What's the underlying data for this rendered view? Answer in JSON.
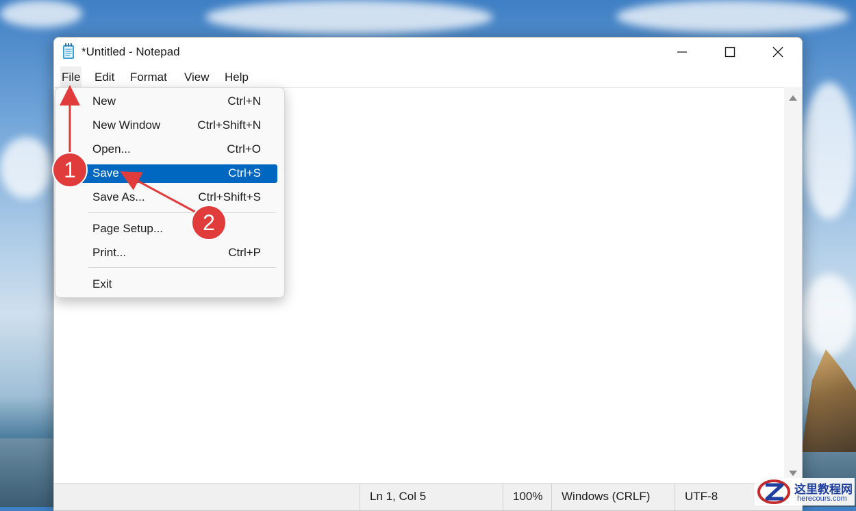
{
  "window": {
    "title": "*Untitled - Notepad",
    "app_icon": "notepad-icon"
  },
  "menubar": {
    "items": [
      "File",
      "Edit",
      "Format",
      "View",
      "Help"
    ],
    "active": "File"
  },
  "file_menu": {
    "items": [
      {
        "label": "New",
        "shortcut": "Ctrl+N"
      },
      {
        "label": "New Window",
        "shortcut": "Ctrl+Shift+N"
      },
      {
        "label": "Open...",
        "shortcut": "Ctrl+O"
      },
      {
        "label": "Save",
        "shortcut": "Ctrl+S",
        "highlighted": true
      },
      {
        "label": "Save As...",
        "shortcut": "Ctrl+Shift+S"
      },
      {
        "label": "Page Setup...",
        "shortcut": ""
      },
      {
        "label": "Print...",
        "shortcut": "Ctrl+P"
      },
      {
        "label": "Exit",
        "shortcut": ""
      }
    ]
  },
  "statusbar": {
    "position": "Ln 1, Col 5",
    "zoom": "100%",
    "line_ending": "Windows (CRLF)",
    "encoding": "UTF-8"
  },
  "annotations": {
    "step1": "1",
    "step2": "2",
    "marker_color": "#e03c3c"
  },
  "watermark": {
    "chinese": "这里教程网",
    "url": "herecours.com"
  },
  "colors": {
    "highlight": "#0067c0"
  }
}
